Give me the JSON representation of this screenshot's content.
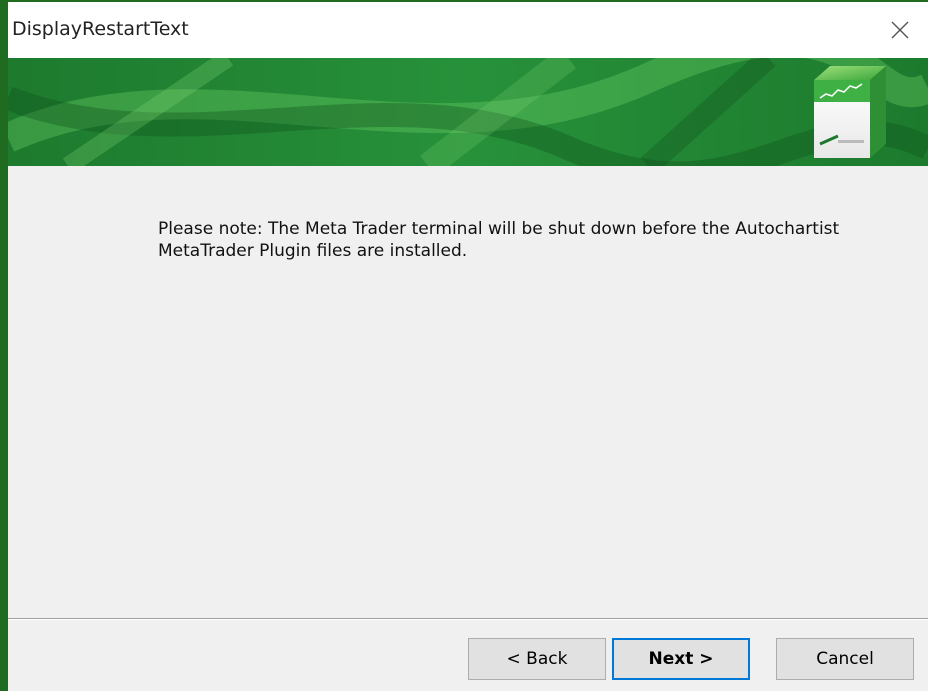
{
  "window": {
    "title": "DisplayRestartText"
  },
  "message": {
    "text": "Please note:  The Meta Trader terminal will be shut down before the Autochartist MetaTrader Plugin files are installed."
  },
  "buttons": {
    "back_label": "< Back",
    "next_label": "Next >",
    "cancel_label": "Cancel"
  },
  "colors": {
    "border": "#1f6b1f",
    "banner_dark": "#0f5a1f",
    "banner_light": "#5fc35a",
    "default_button_outline": "#0078d7"
  },
  "icons": {
    "close": "close-icon",
    "product_box": "product-box-icon"
  }
}
